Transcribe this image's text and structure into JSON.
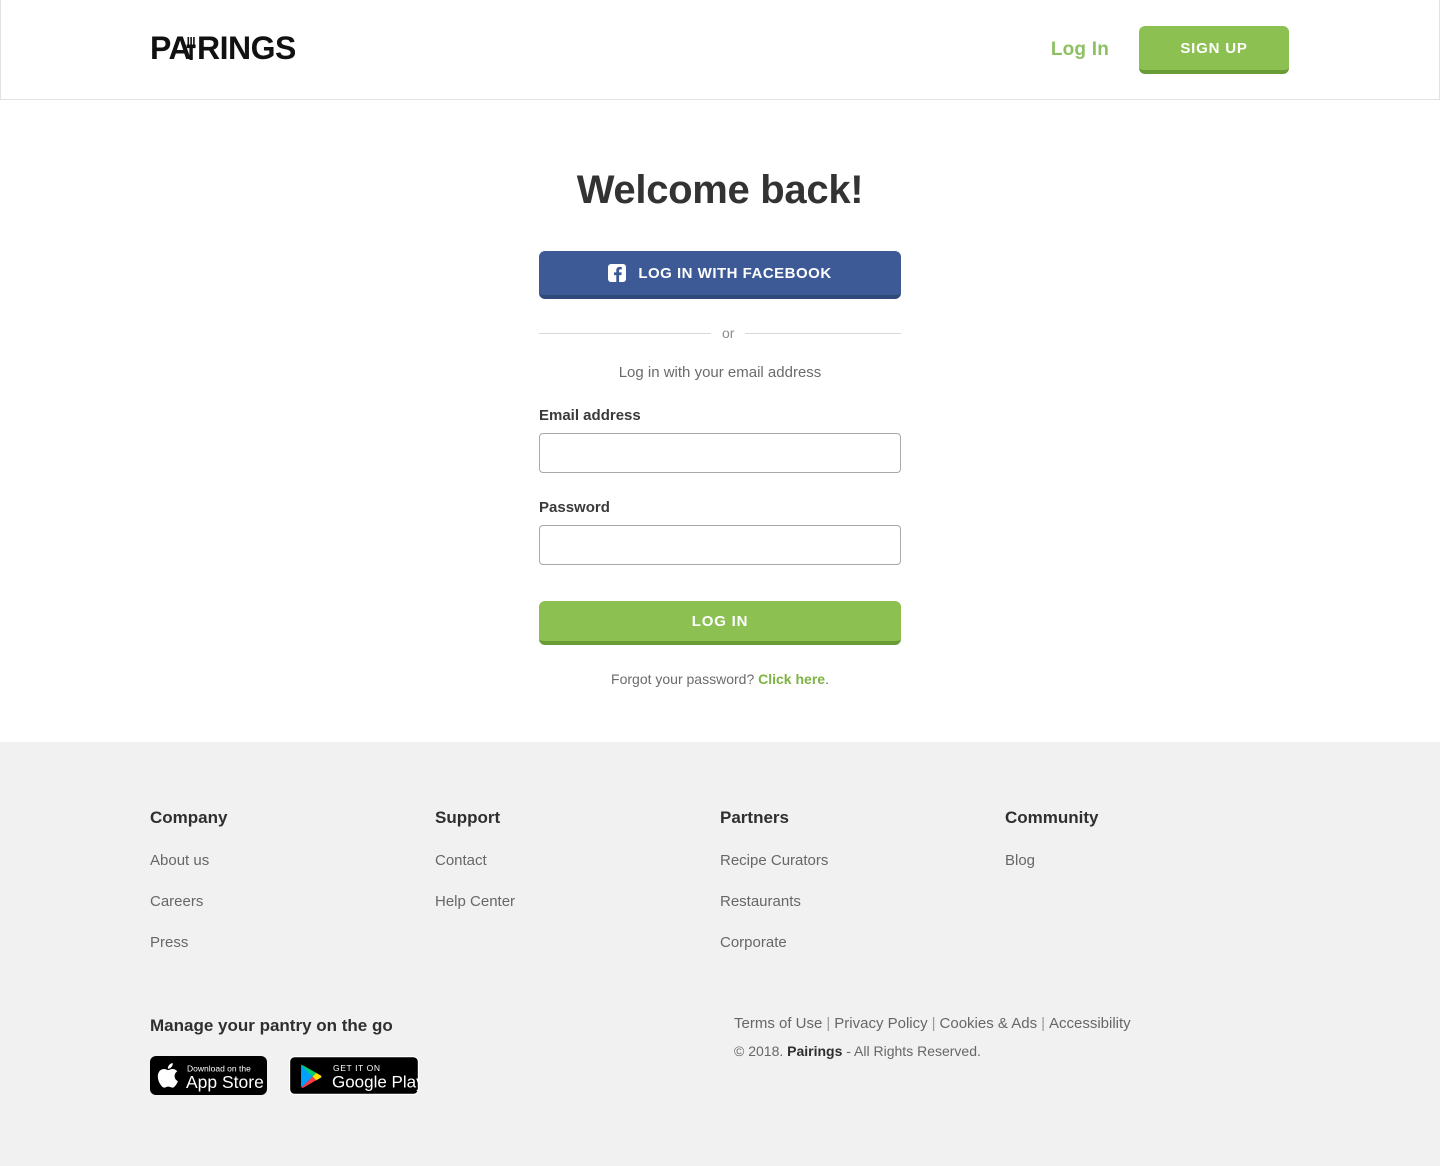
{
  "header": {
    "logo_text": "PAIRINGS",
    "logo_icon": "fork-icon",
    "login_link": "Log In",
    "signup_button": "SIGN UP"
  },
  "main": {
    "title": "Welcome back!",
    "facebook_button": "LOG IN WITH FACEBOOK",
    "facebook_icon": "facebook-icon",
    "divider_text": "or",
    "email_note": "Log in with your email address",
    "email_label": "Email address",
    "email_value": "",
    "email_placeholder": "",
    "password_label": "Password",
    "password_value": "",
    "password_placeholder": "",
    "login_button": "LOG IN",
    "forgot_prefix": "Forgot your password? ",
    "forgot_link": "Click here",
    "forgot_suffix": "."
  },
  "footer": {
    "columns": [
      {
        "heading": "Company",
        "links": [
          "About us",
          "Careers",
          "Press"
        ]
      },
      {
        "heading": "Support",
        "links": [
          "Contact",
          "Help Center"
        ]
      },
      {
        "heading": "Partners",
        "links": [
          "Recipe Curators",
          "Restaurants",
          "Corporate"
        ]
      },
      {
        "heading": "Community",
        "links": [
          "Blog"
        ]
      }
    ],
    "app_heading": "Manage your pantry on the go",
    "badges": [
      {
        "small_text": "Download on the",
        "big_text": "App Store",
        "icon": "apple-icon"
      },
      {
        "small_text": "GET IT ON",
        "big_text": "Google Play",
        "icon": "google-play-icon"
      }
    ],
    "legal_links": [
      "Terms of Use",
      "Privacy Policy",
      "Cookies & Ads",
      "Accessibility"
    ],
    "legal_separator": "|",
    "copyright_prefix": "© 2018. ",
    "copyright_brand": "Pairings",
    "copyright_suffix": " - All Rights Reserved."
  },
  "colors": {
    "brand_green": "#8cc152",
    "brand_green_dark": "#6a9c36",
    "facebook_blue": "#3d5a96",
    "footer_bg": "#f1f1f1",
    "link_green": "#7cb342"
  }
}
